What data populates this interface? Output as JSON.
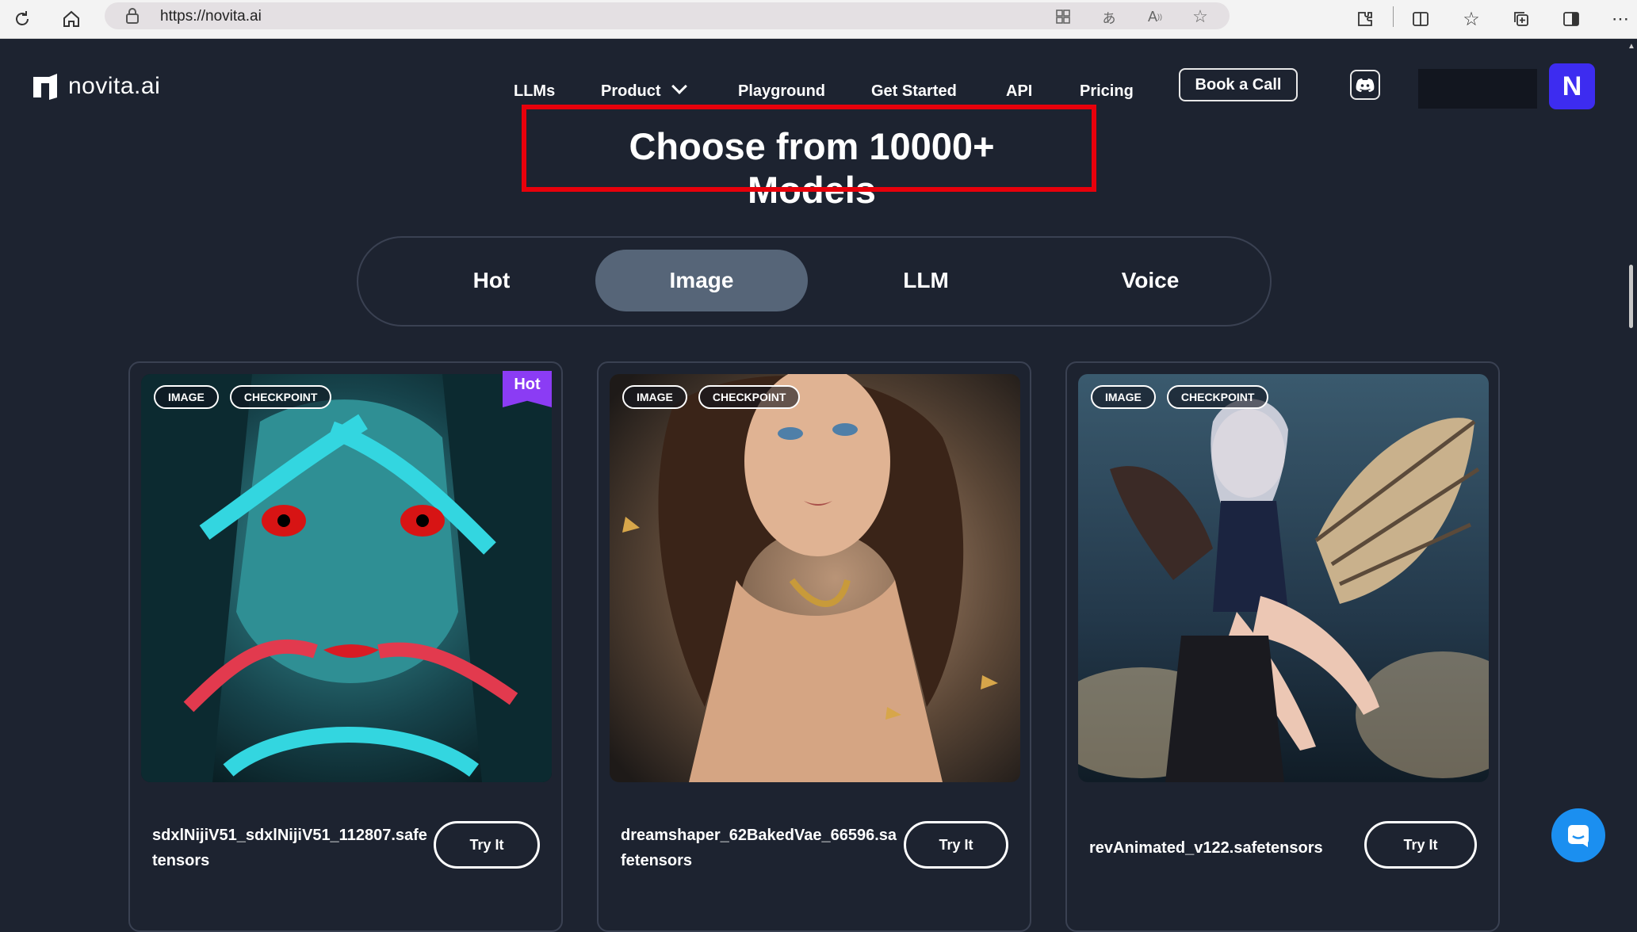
{
  "browser": {
    "url": "https://novita.ai",
    "icons": [
      "refresh-icon",
      "home-icon",
      "lock-icon",
      "app-grid-icon",
      "translate-icon",
      "read-aloud-icon",
      "favorite-star-icon",
      "extensions-icon",
      "split-screen-icon",
      "favorites-icon",
      "collections-icon",
      "sidebar-icon",
      "more-icon"
    ]
  },
  "site": {
    "brand": "novita.ai",
    "nav": [
      "LLMs",
      "Product",
      "Playground",
      "Get Started",
      "API",
      "Pricing"
    ],
    "book_call": "Book a Call",
    "avatar_letter": "N",
    "headline": "Choose from 10000+ Models",
    "tabs": [
      "Hot",
      "Image",
      "LLM",
      "Voice"
    ],
    "active_tab": "Image",
    "accent": "#3d2cf0",
    "highlight_color": "#e8000b"
  },
  "cards": [
    {
      "badges": [
        "IMAGE",
        "CHECKPOINT"
      ],
      "hot": "Hot",
      "title": "sdxlNijiV51_sdxlNijiV51_112807.safetensors",
      "cta": "Try It"
    },
    {
      "badges": [
        "IMAGE",
        "CHECKPOINT"
      ],
      "title": "dreamshaper_62BakedVae_66596.safetensors",
      "cta": "Try It"
    },
    {
      "badges": [
        "IMAGE",
        "CHECKPOINT"
      ],
      "title": "revAnimated_v122.safetensors",
      "cta": "Try It"
    }
  ]
}
